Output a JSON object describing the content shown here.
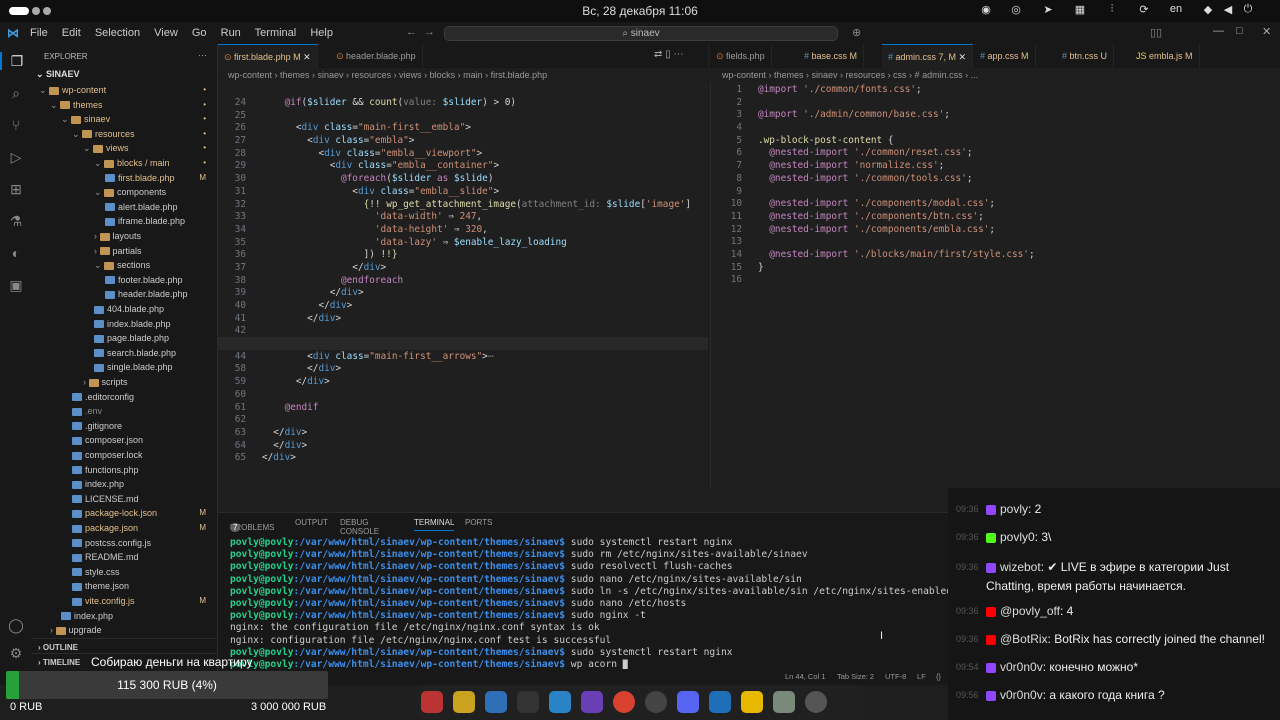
{
  "topbar": {
    "clock": "Вс, 28 декабря  11:06",
    "lang": "en"
  },
  "titlebar": {
    "menu": [
      "File",
      "Edit",
      "Selection",
      "View",
      "Go",
      "Run",
      "Terminal",
      "Help"
    ],
    "search": "sinaev"
  },
  "explorer": {
    "title": "EXPLORER",
    "root": "SINAEV",
    "items": [
      {
        "label": "wp-content",
        "depth": 1,
        "type": "folder",
        "open": true,
        "status": "•",
        "color": "#e2c08d"
      },
      {
        "label": "themes",
        "depth": 2,
        "type": "folder",
        "open": true,
        "status": "•",
        "color": "#e2c08d"
      },
      {
        "label": "sinaev",
        "depth": 3,
        "type": "folder",
        "open": true,
        "status": "•",
        "color": "#e2c08d"
      },
      {
        "label": "resources",
        "depth": 4,
        "type": "folder",
        "open": true,
        "status": "•",
        "color": "#e2c08d"
      },
      {
        "label": "views",
        "depth": 5,
        "type": "folder",
        "open": true,
        "status": "•",
        "color": "#e2c08d"
      },
      {
        "label": "blocks / main",
        "depth": 6,
        "type": "folder",
        "open": true,
        "status": "•",
        "color": "#e2c08d"
      },
      {
        "label": "first.blade.php",
        "depth": 7,
        "type": "file",
        "open": false,
        "status": "M",
        "color": "#e2c08d"
      },
      {
        "label": "components",
        "depth": 6,
        "type": "folder",
        "open": true,
        "status": "",
        "color": "#cccccc"
      },
      {
        "label": "alert.blade.php",
        "depth": 7,
        "type": "file",
        "open": false,
        "status": "",
        "color": "#cccccc"
      },
      {
        "label": "iframe.blade.php",
        "depth": 7,
        "type": "file",
        "open": false,
        "status": "",
        "color": "#cccccc"
      },
      {
        "label": "layouts",
        "depth": 6,
        "type": "folder",
        "open": false,
        "status": "",
        "color": "#cccccc"
      },
      {
        "label": "partials",
        "depth": 6,
        "type": "folder",
        "open": false,
        "status": "",
        "color": "#cccccc"
      },
      {
        "label": "sections",
        "depth": 6,
        "type": "folder",
        "open": true,
        "status": "",
        "color": "#cccccc"
      },
      {
        "label": "footer.blade.php",
        "depth": 7,
        "type": "file",
        "open": false,
        "status": "",
        "color": "#cccccc"
      },
      {
        "label": "header.blade.php",
        "depth": 7,
        "type": "file",
        "open": false,
        "status": "",
        "color": "#cccccc"
      },
      {
        "label": "404.blade.php",
        "depth": 6,
        "type": "file",
        "open": false,
        "status": "",
        "color": "#cccccc"
      },
      {
        "label": "index.blade.php",
        "depth": 6,
        "type": "file",
        "open": false,
        "status": "",
        "color": "#cccccc"
      },
      {
        "label": "page.blade.php",
        "depth": 6,
        "type": "file",
        "open": false,
        "status": "",
        "color": "#cccccc"
      },
      {
        "label": "search.blade.php",
        "depth": 6,
        "type": "file",
        "open": false,
        "status": "",
        "color": "#cccccc"
      },
      {
        "label": "single.blade.php",
        "depth": 6,
        "type": "file",
        "open": false,
        "status": "",
        "color": "#cccccc"
      },
      {
        "label": "scripts",
        "depth": 5,
        "type": "folder",
        "open": false,
        "status": "",
        "color": "#cccccc"
      },
      {
        "label": ".editorconfig",
        "depth": 4,
        "type": "file",
        "open": false,
        "status": "",
        "color": "#cccccc"
      },
      {
        "label": ".env",
        "depth": 4,
        "type": "file",
        "open": false,
        "status": "",
        "color": "#8a8a8a"
      },
      {
        "label": ".gitignore",
        "depth": 4,
        "type": "file",
        "open": false,
        "status": "",
        "color": "#cccccc"
      },
      {
        "label": "composer.json",
        "depth": 4,
        "type": "file",
        "open": false,
        "status": "",
        "color": "#cccccc"
      },
      {
        "label": "composer.lock",
        "depth": 4,
        "type": "file",
        "open": false,
        "status": "",
        "color": "#cccccc"
      },
      {
        "label": "functions.php",
        "depth": 4,
        "type": "file",
        "open": false,
        "status": "",
        "color": "#cccccc"
      },
      {
        "label": "index.php",
        "depth": 4,
        "type": "file",
        "open": false,
        "status": "",
        "color": "#cccccc"
      },
      {
        "label": "LICENSE.md",
        "depth": 4,
        "type": "file",
        "open": false,
        "status": "",
        "color": "#cccccc"
      },
      {
        "label": "package-lock.json",
        "depth": 4,
        "type": "file",
        "open": false,
        "status": "M",
        "color": "#e2c08d"
      },
      {
        "label": "package.json",
        "depth": 4,
        "type": "file",
        "open": false,
        "status": "M",
        "color": "#e2c08d"
      },
      {
        "label": "postcss.config.js",
        "depth": 4,
        "type": "file",
        "open": false,
        "status": "",
        "color": "#cccccc"
      },
      {
        "label": "README.md",
        "depth": 4,
        "type": "file",
        "open": false,
        "status": "",
        "color": "#cccccc"
      },
      {
        "label": "style.css",
        "depth": 4,
        "type": "file",
        "open": false,
        "status": "",
        "color": "#cccccc"
      },
      {
        "label": "theme.json",
        "depth": 4,
        "type": "file",
        "open": false,
        "status": "",
        "color": "#cccccc"
      },
      {
        "label": "vite.config.js",
        "depth": 4,
        "type": "file",
        "open": false,
        "status": "M",
        "color": "#e2c08d"
      },
      {
        "label": "index.php",
        "depth": 3,
        "type": "file",
        "open": false,
        "status": "",
        "color": "#cccccc"
      },
      {
        "label": "upgrade",
        "depth": 2,
        "type": "folder",
        "open": false,
        "status": "",
        "color": "#cccccc"
      }
    ],
    "outline": "OUTLINE",
    "timeline": "TIMELINE"
  },
  "editor_left": {
    "tabs": [
      {
        "label": "first.blade.php",
        "status": "M",
        "active": true
      },
      {
        "label": "header.blade.php",
        "status": "",
        "active": false
      }
    ],
    "breadcrumb": "wp-content › themes › sinaev › resources › views › blocks › main › first.blade.php",
    "line_numbers": [
      "24",
      "25",
      "26",
      "27",
      "28",
      "29",
      "30",
      "31",
      "32",
      "33",
      "34",
      "35",
      "36",
      "37",
      "38",
      "39",
      "40",
      "41",
      "42",
      "43",
      "44",
      "58",
      "59",
      "60",
      "61",
      "62",
      "63",
      "64",
      "65"
    ],
    "lines": [
      [
        [
          "kw",
          "    @if"
        ],
        [
          "pu",
          "("
        ],
        [
          "vr",
          "$slider"
        ],
        [
          "pu",
          " && "
        ],
        [
          "fn",
          "count"
        ],
        [
          "pu",
          "("
        ],
        [
          "dm",
          "value: "
        ],
        [
          "vr",
          "$slider"
        ],
        [
          "pu",
          ") > 0)"
        ]
      ],
      [
        [
          "pu",
          ""
        ]
      ],
      [
        [
          "pu",
          "      <"
        ],
        [
          "tg",
          "div "
        ],
        [
          "at",
          "class"
        ],
        [
          "pu",
          "="
        ],
        [
          "str",
          "\"main-first__embla\""
        ],
        [
          "pu",
          ">"
        ]
      ],
      [
        [
          "pu",
          "        <"
        ],
        [
          "tg",
          "div "
        ],
        [
          "at",
          "class"
        ],
        [
          "pu",
          "="
        ],
        [
          "str",
          "\"embla\""
        ],
        [
          "pu",
          ">"
        ]
      ],
      [
        [
          "pu",
          "          <"
        ],
        [
          "tg",
          "div "
        ],
        [
          "at",
          "class"
        ],
        [
          "pu",
          "="
        ],
        [
          "str",
          "\"embla__viewport\""
        ],
        [
          "pu",
          ">"
        ]
      ],
      [
        [
          "pu",
          "            <"
        ],
        [
          "tg",
          "div "
        ],
        [
          "at",
          "class"
        ],
        [
          "pu",
          "="
        ],
        [
          "str",
          "\"embla__container\""
        ],
        [
          "pu",
          ">"
        ]
      ],
      [
        [
          "kw",
          "              @foreach"
        ],
        [
          "pu",
          "("
        ],
        [
          "vr",
          "$slider"
        ],
        [
          "kw",
          " as "
        ],
        [
          "vr",
          "$slide"
        ],
        [
          "pu",
          ")"
        ]
      ],
      [
        [
          "pu",
          "                <"
        ],
        [
          "tg",
          "div "
        ],
        [
          "at",
          "class"
        ],
        [
          "pu",
          "="
        ],
        [
          "str",
          "\"embla__slide\""
        ],
        [
          "pu",
          ">"
        ]
      ],
      [
        [
          "fn",
          "                  {!! "
        ],
        [
          "fn",
          "wp_get_attachment_image"
        ],
        [
          "pu",
          "("
        ],
        [
          "dm",
          "attachment_id: "
        ],
        [
          "vr",
          "$slide"
        ],
        [
          "pu",
          "["
        ],
        [
          "str",
          "'image'"
        ],
        [
          "pu",
          "]"
        ]
      ],
      [
        [
          "str",
          "                    'data-width'"
        ],
        [
          "pu",
          " ⇒ "
        ],
        [
          "str",
          "247"
        ],
        [
          "pu",
          ","
        ]
      ],
      [
        [
          "str",
          "                    'data-height'"
        ],
        [
          "pu",
          " ⇒ "
        ],
        [
          "str",
          "320"
        ],
        [
          "pu",
          ","
        ]
      ],
      [
        [
          "str",
          "                    'data-lazy'"
        ],
        [
          "pu",
          " ⇒ "
        ],
        [
          "vr",
          "$enable_lazy_loading"
        ]
      ],
      [
        [
          "pu",
          "                  ]) "
        ],
        [
          "fn",
          "!!}"
        ]
      ],
      [
        [
          "pu",
          "                </"
        ],
        [
          "tg",
          "div"
        ],
        [
          "pu",
          ">"
        ]
      ],
      [
        [
          "kw",
          "              @endforeach"
        ]
      ],
      [
        [
          "pu",
          "            </"
        ],
        [
          "tg",
          "div"
        ],
        [
          "pu",
          ">"
        ]
      ],
      [
        [
          "pu",
          "          </"
        ],
        [
          "tg",
          "div"
        ],
        [
          "pu",
          ">"
        ]
      ],
      [
        [
          "pu",
          "        </"
        ],
        [
          "tg",
          "div"
        ],
        [
          "pu",
          ">"
        ]
      ],
      [
        [
          "pu",
          ""
        ]
      ],
      [
        [
          "pu",
          ""
        ]
      ],
      [
        [
          "pu",
          "        <"
        ],
        [
          "tg",
          "div "
        ],
        [
          "at",
          "class"
        ],
        [
          "pu",
          "="
        ],
        [
          "str",
          "\"main-first__arrows\""
        ],
        [
          "pu",
          ">"
        ],
        [
          "dm",
          "⋯"
        ]
      ],
      [
        [
          "pu",
          "        </"
        ],
        [
          "tg",
          "div"
        ],
        [
          "pu",
          ">"
        ]
      ],
      [
        [
          "pu",
          "      </"
        ],
        [
          "tg",
          "div"
        ],
        [
          "pu",
          ">"
        ]
      ],
      [
        [
          "pu",
          ""
        ]
      ],
      [
        [
          "kw",
          "    @endif"
        ]
      ],
      [
        [
          "pu",
          ""
        ]
      ],
      [
        [
          "pu",
          "  </"
        ],
        [
          "tg",
          "div"
        ],
        [
          "pu",
          ">"
        ]
      ],
      [
        [
          "pu",
          "  </"
        ],
        [
          "tg",
          "div"
        ],
        [
          "pu",
          ">"
        ]
      ],
      [
        [
          "pu",
          "</"
        ],
        [
          "tg",
          "div"
        ],
        [
          "pu",
          ">"
        ]
      ]
    ]
  },
  "editor_right": {
    "tabs": [
      {
        "label": "fields.php",
        "status": "",
        "active": false
      },
      {
        "label": "base.css",
        "status": "M",
        "active": false
      },
      {
        "label": "admin.css",
        "status": "7, M",
        "active": true
      },
      {
        "label": "app.css",
        "status": "M",
        "active": false
      },
      {
        "label": "btn.css",
        "status": "U",
        "active": false
      },
      {
        "label": "embla.js",
        "status": "M",
        "active": false
      }
    ],
    "breadcrumb": "wp-content › themes › sinaev › resources › css › # admin.css › ...",
    "line_numbers": [
      "1",
      "2",
      "3",
      "4",
      "5",
      "6",
      "7",
      "8",
      "9",
      "10",
      "11",
      "12",
      "13",
      "14",
      "15",
      "16"
    ],
    "lines": [
      [
        [
          "kw",
          "@import"
        ],
        [
          "str",
          " './common/fonts.css'"
        ],
        [
          "pu",
          ";"
        ]
      ],
      [
        [
          "pu",
          ""
        ]
      ],
      [
        [
          "kw",
          "@import"
        ],
        [
          "str",
          " './admin/common/base.css'"
        ],
        [
          "pu",
          ";"
        ]
      ],
      [
        [
          "pu",
          ""
        ]
      ],
      [
        [
          "fn",
          ".wp-block-post-content"
        ],
        [
          "pu",
          " {"
        ]
      ],
      [
        [
          "kw",
          "  @nested-import"
        ],
        [
          "str",
          " './common/reset.css'"
        ],
        [
          "pu",
          ";"
        ]
      ],
      [
        [
          "kw",
          "  @nested-import"
        ],
        [
          "str",
          " 'normalize.css'"
        ],
        [
          "pu",
          ";"
        ]
      ],
      [
        [
          "kw",
          "  @nested-import"
        ],
        [
          "str",
          " './common/tools.css'"
        ],
        [
          "pu",
          ";"
        ]
      ],
      [
        [
          "pu",
          ""
        ]
      ],
      [
        [
          "kw",
          "  @nested-import"
        ],
        [
          "str",
          " './components/modal.css'"
        ],
        [
          "pu",
          ";"
        ]
      ],
      [
        [
          "kw",
          "  @nested-import"
        ],
        [
          "str",
          " './components/btn.css'"
        ],
        [
          "pu",
          ";"
        ]
      ],
      [
        [
          "kw",
          "  @nested-import"
        ],
        [
          "str",
          " './components/embla.css'"
        ],
        [
          "pu",
          ";"
        ]
      ],
      [
        [
          "pu",
          ""
        ]
      ],
      [
        [
          "kw",
          "  @nested-import"
        ],
        [
          "str",
          " './blocks/main/first/style.css'"
        ],
        [
          "pu",
          ";"
        ]
      ],
      [
        [
          "pu",
          "}"
        ]
      ],
      [
        [
          "pu",
          ""
        ]
      ]
    ]
  },
  "panel": {
    "tabs": [
      "PROBLEMS",
      "OUTPUT",
      "DEBUG CONSOLE",
      "TERMINAL",
      "PORTS"
    ],
    "problems_count": "7",
    "prompt": "povly@povly",
    "path": ":/var/www/html/sinaev/wp-content/themes/sinaev$",
    "lines": [
      {
        "type": "cmd",
        "text": " sudo systemctl restart nginx"
      },
      {
        "type": "cmd",
        "text": " sudo rm /etc/nginx/sites-available/sinaev"
      },
      {
        "type": "cmd",
        "text": " sudo resolvectl flush-caches"
      },
      {
        "type": "cmd",
        "text": " sudo nano /etc/nginx/sites-available/sin"
      },
      {
        "type": "cmd",
        "text": " sudo ln -s /etc/nginx/sites-available/sin /etc/nginx/sites-enabled"
      },
      {
        "type": "cmd",
        "text": " sudo nano /etc/hosts"
      },
      {
        "type": "cmd",
        "text": " sudo nginx -t"
      },
      {
        "type": "out",
        "text": "nginx: the configuration file /etc/nginx/nginx.conf syntax is ok"
      },
      {
        "type": "out",
        "text": "nginx: configuration file /etc/nginx/nginx.conf test is successful"
      },
      {
        "type": "cmd",
        "text": " sudo systemctl restart nginx"
      },
      {
        "type": "cmd",
        "text": " wp acorn "
      }
    ]
  },
  "statusbar": {
    "pos": "Ln 44, Col 1",
    "tab": "Tab Size: 2",
    "enc": "UTF-8",
    "eol": "LF",
    "lang": "{}"
  },
  "chat": [
    {
      "time": "09:36",
      "icon": "twitch",
      "user": "povly",
      "text": ": 2"
    },
    {
      "time": "09:36",
      "icon": "kick",
      "user": "povly0",
      "text": ": 3\\"
    },
    {
      "time": "09:36",
      "icon": "twitch",
      "user": "wizebot",
      "text": ": ✔ LIVE в эфире в категории Just Chatting, время работы начинается."
    },
    {
      "time": "09:36",
      "icon": "youtube",
      "user": "@povly_off",
      "text": ": 4"
    },
    {
      "time": "09:36",
      "icon": "youtube",
      "user": "@BotRix",
      "text": ": BotRix has correctly joined the channel!"
    },
    {
      "time": "09:54",
      "icon": "twitch",
      "user": "v0r0n0v",
      "text": ": конечно можно*"
    },
    {
      "time": "09:56",
      "icon": "twitch",
      "user": "v0r0n0v",
      "text": ": а какого года книга ?"
    }
  ],
  "donation": {
    "title": "Собираю деньги на квартиру",
    "amount": "115 300 RUB (4%)",
    "progress": 0.04,
    "min": "0 RUB",
    "max": "3 000 000 RUB"
  }
}
